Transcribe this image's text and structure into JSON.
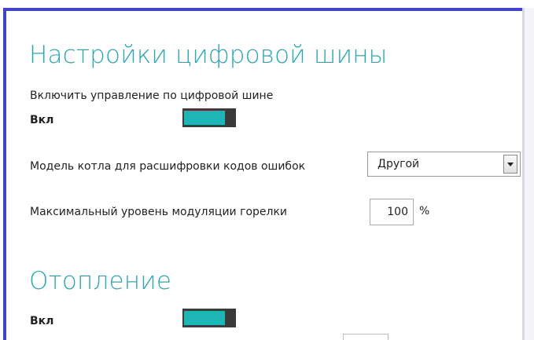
{
  "digital_bus": {
    "title": "Настройки цифровой шины",
    "enable_label": "Включить управление по цифровой шине",
    "state_label": "Вкл",
    "toggle_on": true,
    "boiler_model_label": "Модель котла для расшифровки кодов ошибок",
    "boiler_model_value": "Другой",
    "max_modulation_label": "Максимальный уровень модуляции горелки",
    "max_modulation_value": "100",
    "max_modulation_unit": "%"
  },
  "heating": {
    "title": "Отопление",
    "state_label": "Вкл",
    "toggle_on": true
  },
  "colors": {
    "accent": "#2ba7b2",
    "toggle_on": "#1fb5b6",
    "frame_border": "#3f43c8"
  },
  "icons": {
    "select_arrow": "chevron-down-icon"
  }
}
